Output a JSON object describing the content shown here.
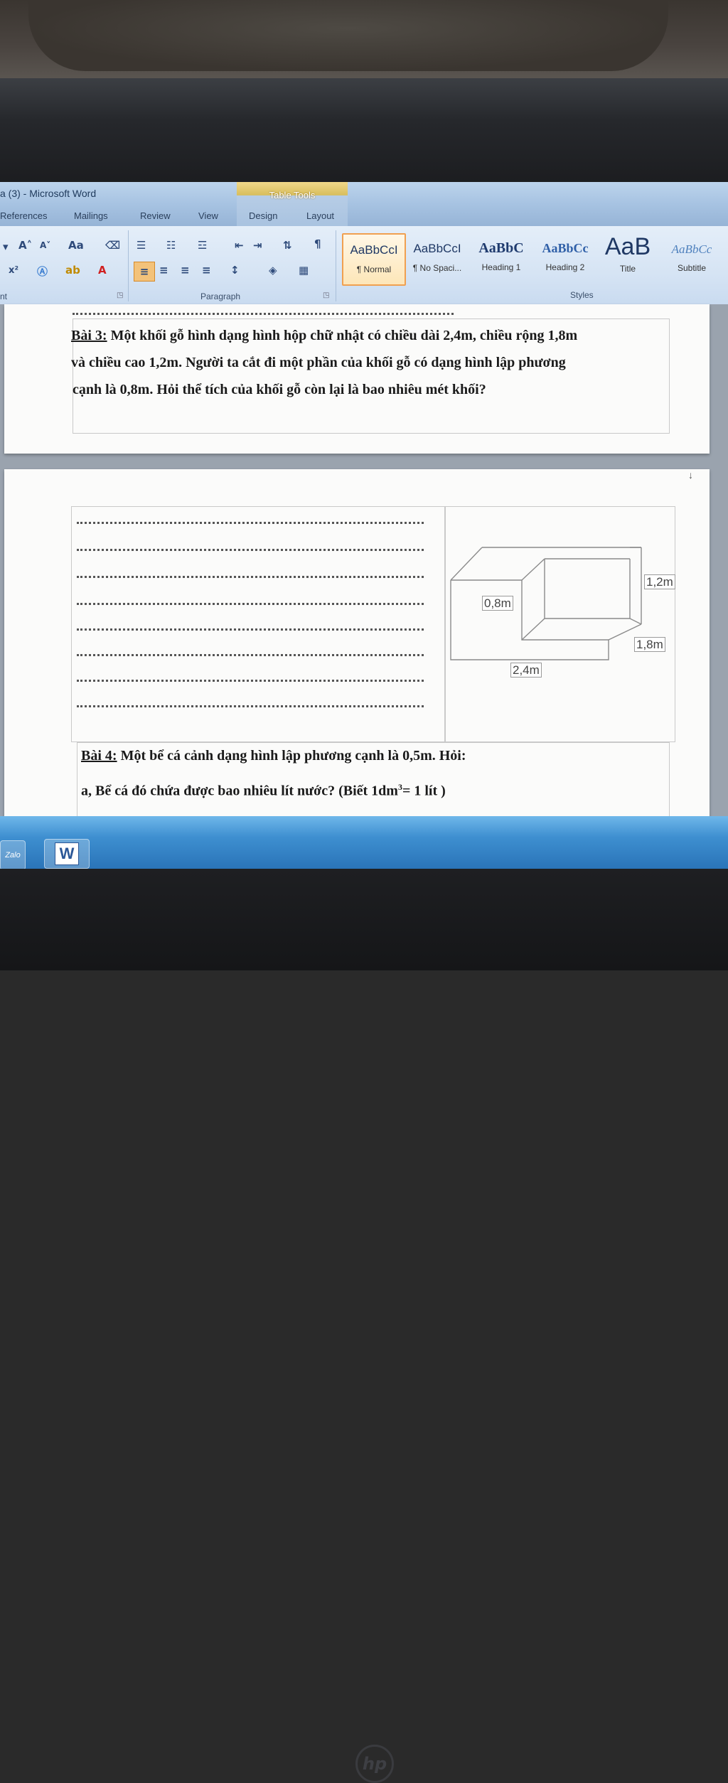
{
  "window": {
    "title": "a (3)  -  Microsoft Word",
    "context_tab_group": "Table Tools",
    "tabs": [
      "References",
      "Mailings",
      "Review",
      "View",
      "Design",
      "Layout"
    ]
  },
  "ribbon": {
    "groups": {
      "font_partial": "nt",
      "paragraph": "Paragraph",
      "styles": "Styles"
    },
    "font_size_label": "Aa",
    "styles": [
      {
        "preview": "AaBbCcI",
        "name": "¶ Normal",
        "selected": true
      },
      {
        "preview": "AaBbCcI",
        "name": "¶ No Spaci..."
      },
      {
        "preview": "AaBbC",
        "name": "Heading 1"
      },
      {
        "preview": "AaBbCc",
        "name": "Heading 2"
      },
      {
        "preview": "AaB",
        "name": "Title"
      },
      {
        "preview": "AaBbCc",
        "name": "Subtitle"
      }
    ]
  },
  "document": {
    "bai3": {
      "label": "Bài 3:",
      "line1": " Một khối gỗ hình dạng hình hộp chữ nhật có chiều dài 2,4m, chiều rộng 1,8m",
      "line2": "và chiều cao 1,2m. Người ta cắt đi một phần của khối gỗ có dạng hình lập phương",
      "line3": "cạnh là 0,8m. Hỏi thể  tích của khối gỗ còn lại là bao nhiêu mét khối?"
    },
    "figure": {
      "height_label": "1,2m",
      "cut_label": "0,8m",
      "width_label": "1,8m",
      "length_label": "2,4m"
    },
    "bai4": {
      "label": "Bài 4:",
      "line1": " Một bể cá cảnh dạng hình lập phương cạnh là 0,5m. Hỏi:",
      "line2_pre": "a, Bể cá đó chứa được bao nhiêu lít nước? (Biết 1dm",
      "line2_sup": "3",
      "line2_post": "=  1 lít )"
    }
  },
  "taskbar": {
    "apps": [
      {
        "label": "Zalo",
        "icon": "zalo-icon"
      },
      {
        "label": "W",
        "icon": "word-icon"
      }
    ]
  },
  "device": {
    "brand": "hp"
  }
}
